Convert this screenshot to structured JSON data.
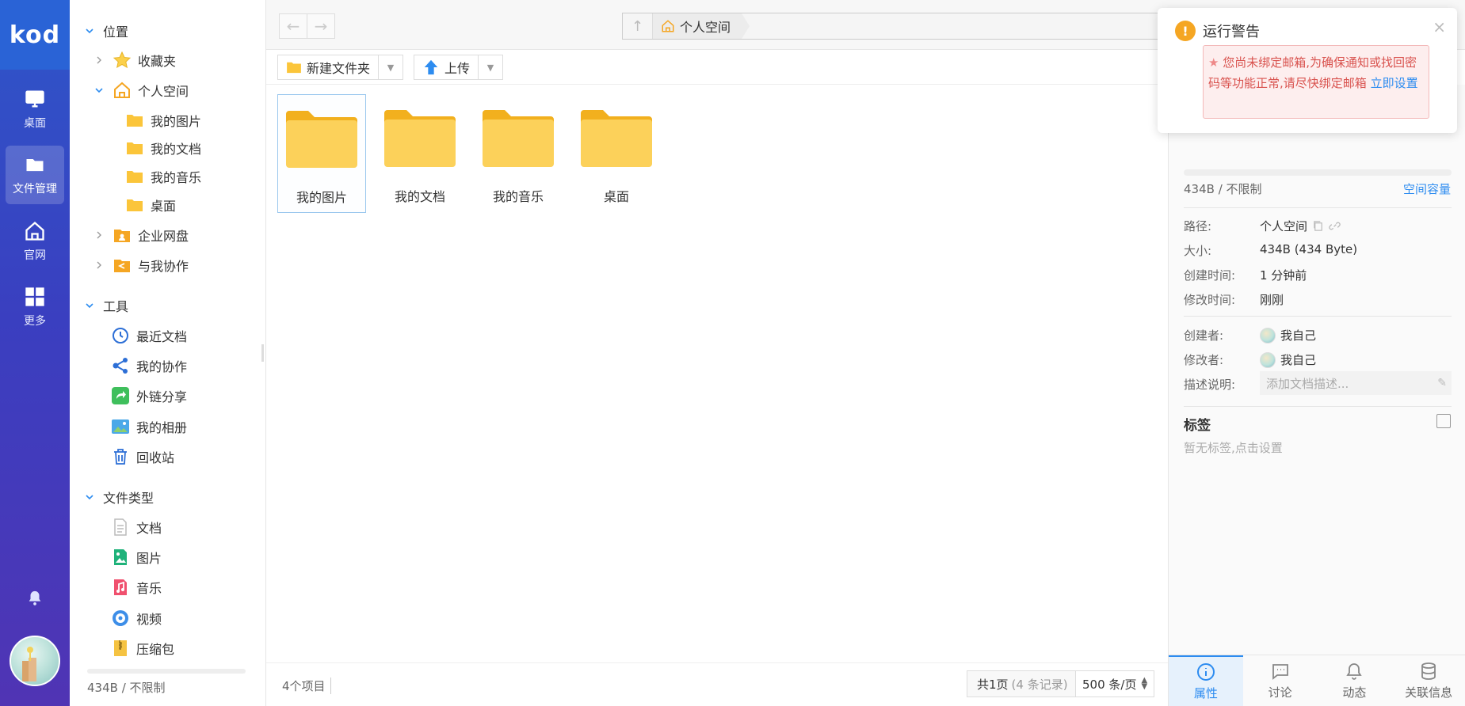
{
  "app": {
    "logo": "kod"
  },
  "rail": {
    "items": [
      {
        "label": "桌面",
        "icon": "monitor-icon"
      },
      {
        "label": "文件管理",
        "icon": "folder-icon"
      },
      {
        "label": "官网",
        "icon": "home-icon"
      },
      {
        "label": "更多",
        "icon": "grid-icon"
      }
    ],
    "active": "文件管理"
  },
  "sidebar": {
    "sections": [
      {
        "label": "位置",
        "items": [
          {
            "label": "收藏夹",
            "icon": "star-icon"
          },
          {
            "label": "个人空间",
            "icon": "home-icon",
            "children": [
              {
                "label": "我的图片"
              },
              {
                "label": "我的文档"
              },
              {
                "label": "我的音乐"
              },
              {
                "label": "桌面"
              }
            ]
          },
          {
            "label": "企业网盘",
            "icon": "enterprise-drive-icon"
          },
          {
            "label": "与我协作",
            "icon": "share-folder-icon"
          }
        ]
      },
      {
        "label": "工具",
        "items": [
          {
            "label": "最近文档",
            "icon": "clock-icon"
          },
          {
            "label": "我的协作",
            "icon": "collab-icon"
          },
          {
            "label": "外链分享",
            "icon": "share-link-icon"
          },
          {
            "label": "我的相册",
            "icon": "album-icon"
          },
          {
            "label": "回收站",
            "icon": "trash-icon"
          }
        ]
      },
      {
        "label": "文件类型",
        "items": [
          {
            "label": "文档",
            "icon": "doc-icon"
          },
          {
            "label": "图片",
            "icon": "image-icon"
          },
          {
            "label": "音乐",
            "icon": "music-icon"
          },
          {
            "label": "视频",
            "icon": "video-icon"
          },
          {
            "label": "压缩包",
            "icon": "zip-icon"
          }
        ]
      }
    ],
    "quota": "434B / 不限制"
  },
  "header": {
    "breadcrumb": [
      "个人空间"
    ]
  },
  "toolbar": {
    "new_folder": "新建文件夹",
    "upload": "上传"
  },
  "files": [
    {
      "name": "我的图片",
      "selected": true
    },
    {
      "name": "我的文档",
      "selected": false
    },
    {
      "name": "我的音乐",
      "selected": false
    },
    {
      "name": "桌面",
      "selected": false
    }
  ],
  "status": {
    "count": "4个项目",
    "pages": "共1页",
    "records": "(4 条记录)",
    "page_size": "500 条/页"
  },
  "panel": {
    "size_summary": "434B / 不限制",
    "capacity_link": "空间容量",
    "props": [
      {
        "key": "路径:",
        "value": "个人空间"
      },
      {
        "key": "大小:",
        "value": "434B (434 Byte)"
      },
      {
        "key": "创建时间:",
        "value": "1 分钟前"
      },
      {
        "key": "修改时间:",
        "value": "刚刚"
      }
    ],
    "people": [
      {
        "key": "创建者:",
        "value": "我自己"
      },
      {
        "key": "修改者:",
        "value": "我自己"
      }
    ],
    "desc_key": "描述说明:",
    "desc_placeholder": "添加文档描述...",
    "tags_title": "标签",
    "tags_empty": "暂无标签,点击设置",
    "tabs": [
      {
        "label": "属性",
        "icon": "info-icon"
      },
      {
        "label": "讨论",
        "icon": "comment-icon"
      },
      {
        "label": "动态",
        "icon": "bell-icon"
      },
      {
        "label": "关联信息",
        "icon": "database-icon"
      }
    ],
    "active_tab": "属性"
  },
  "toast": {
    "title": "运行警告",
    "message": "您尚未绑定邮箱,为确保通知或找回密码等功能正常,请尽快绑定邮箱",
    "link": "立即设置"
  },
  "colors": {
    "accent": "#2d8cf0",
    "rail_top": "#2e56c9",
    "rail_bottom": "#5034b4",
    "folder": "#fbc53a",
    "warning": "#f5a623"
  }
}
